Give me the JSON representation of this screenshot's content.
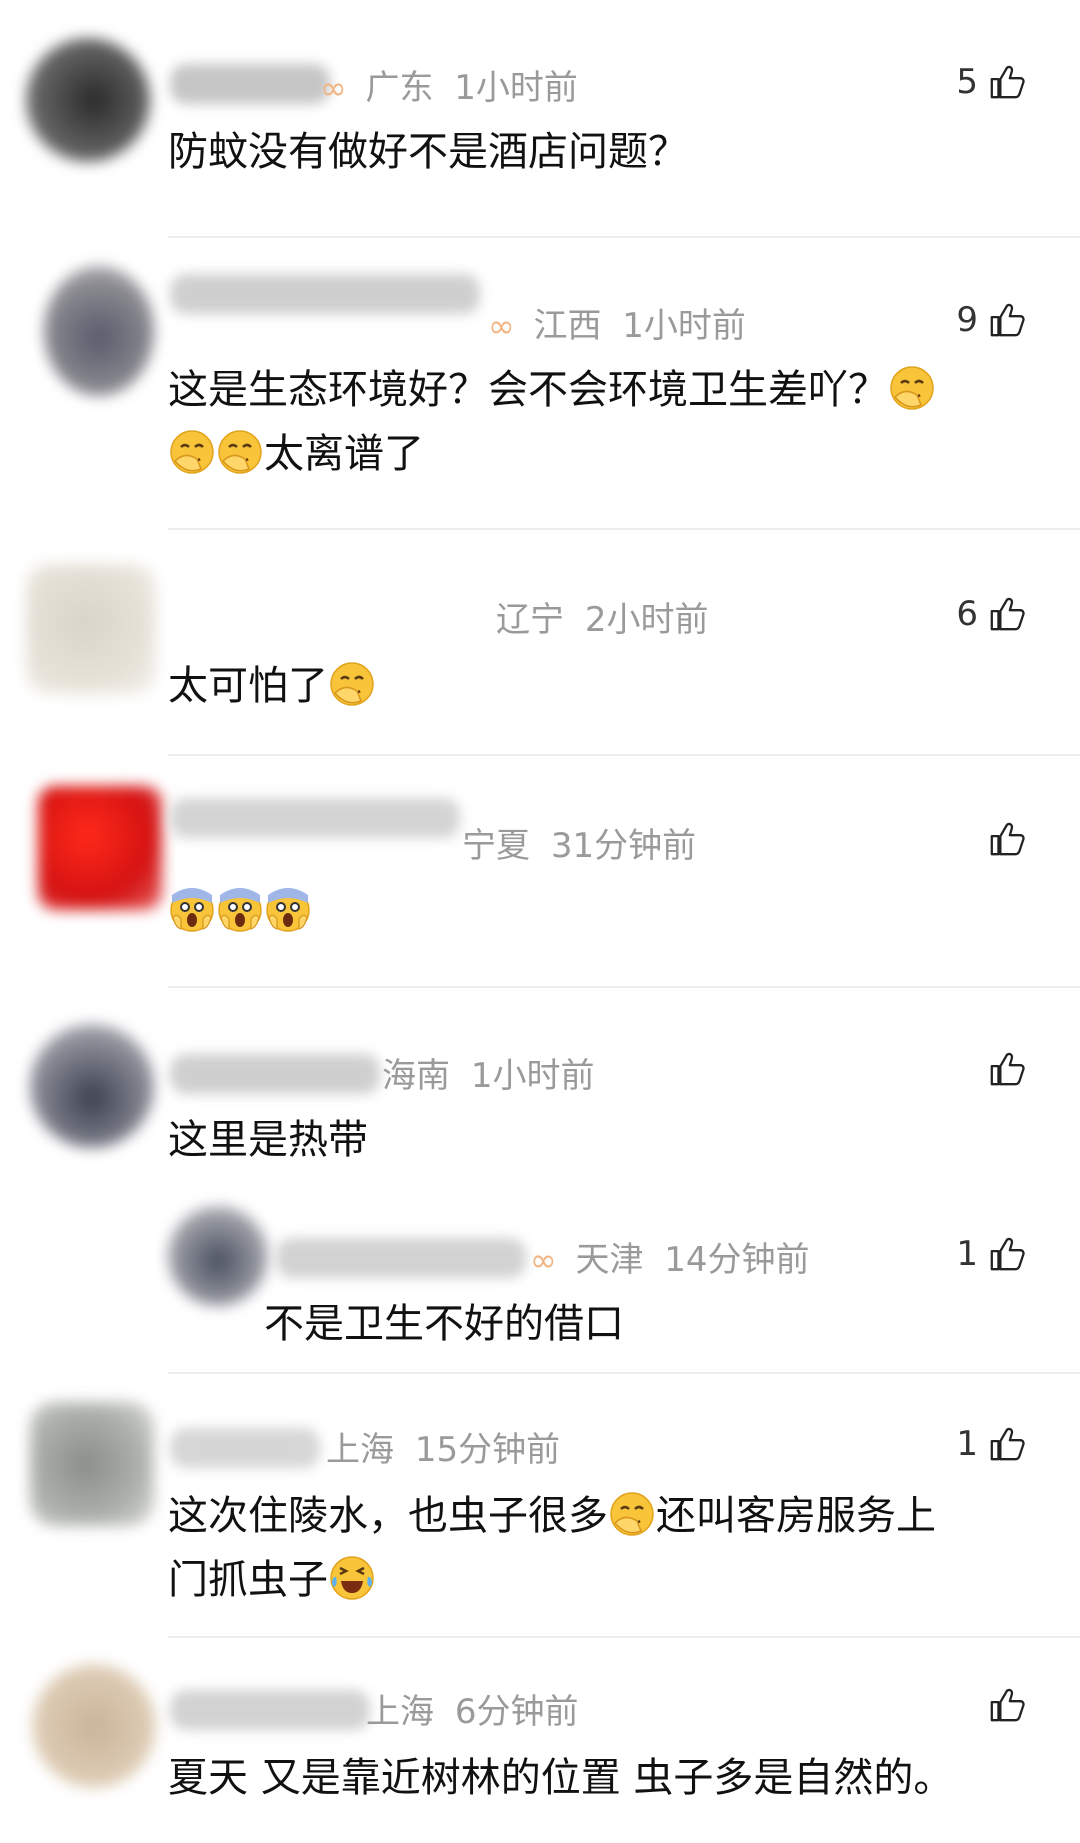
{
  "comments": [
    {
      "location": "广东",
      "time": "1小时前",
      "likes": "5",
      "text": "防蚊没有做好不是酒店问题？"
    },
    {
      "location": "江西",
      "time": "1小时前",
      "likes": "9",
      "text_line1": "这是生态环境好？会不会环境卫生差吖？",
      "text_line2": "太离谱了"
    },
    {
      "location": "辽宁",
      "time": "2小时前",
      "likes": "6",
      "text": "太可怕了"
    },
    {
      "location": "宁夏",
      "time": "31分钟前",
      "likes": ""
    },
    {
      "location": "海南",
      "time": "1小时前",
      "likes": "",
      "text": "这里是热带"
    },
    {
      "location": "天津",
      "time": "14分钟前",
      "likes": "1",
      "text": "不是卫生不好的借口"
    },
    {
      "location": "上海",
      "time": "15分钟前",
      "likes": "1",
      "text_line1": "这次住陵水，也虫子很多",
      "text_line1b": "还叫客房服务上",
      "text_line2": "门抓虫子"
    },
    {
      "location": "上海",
      "time": "6分钟前",
      "likes": "",
      "text": "夏天 又是靠近树林的位置 虫子多是自然的。"
    }
  ],
  "icons": {
    "like": "thumbs-up-icon",
    "vip": "vip-badge-icon",
    "facepalm": "facepalm-emoji",
    "scream": "scream-emoji",
    "laugh": "laugh-cry-emoji"
  }
}
